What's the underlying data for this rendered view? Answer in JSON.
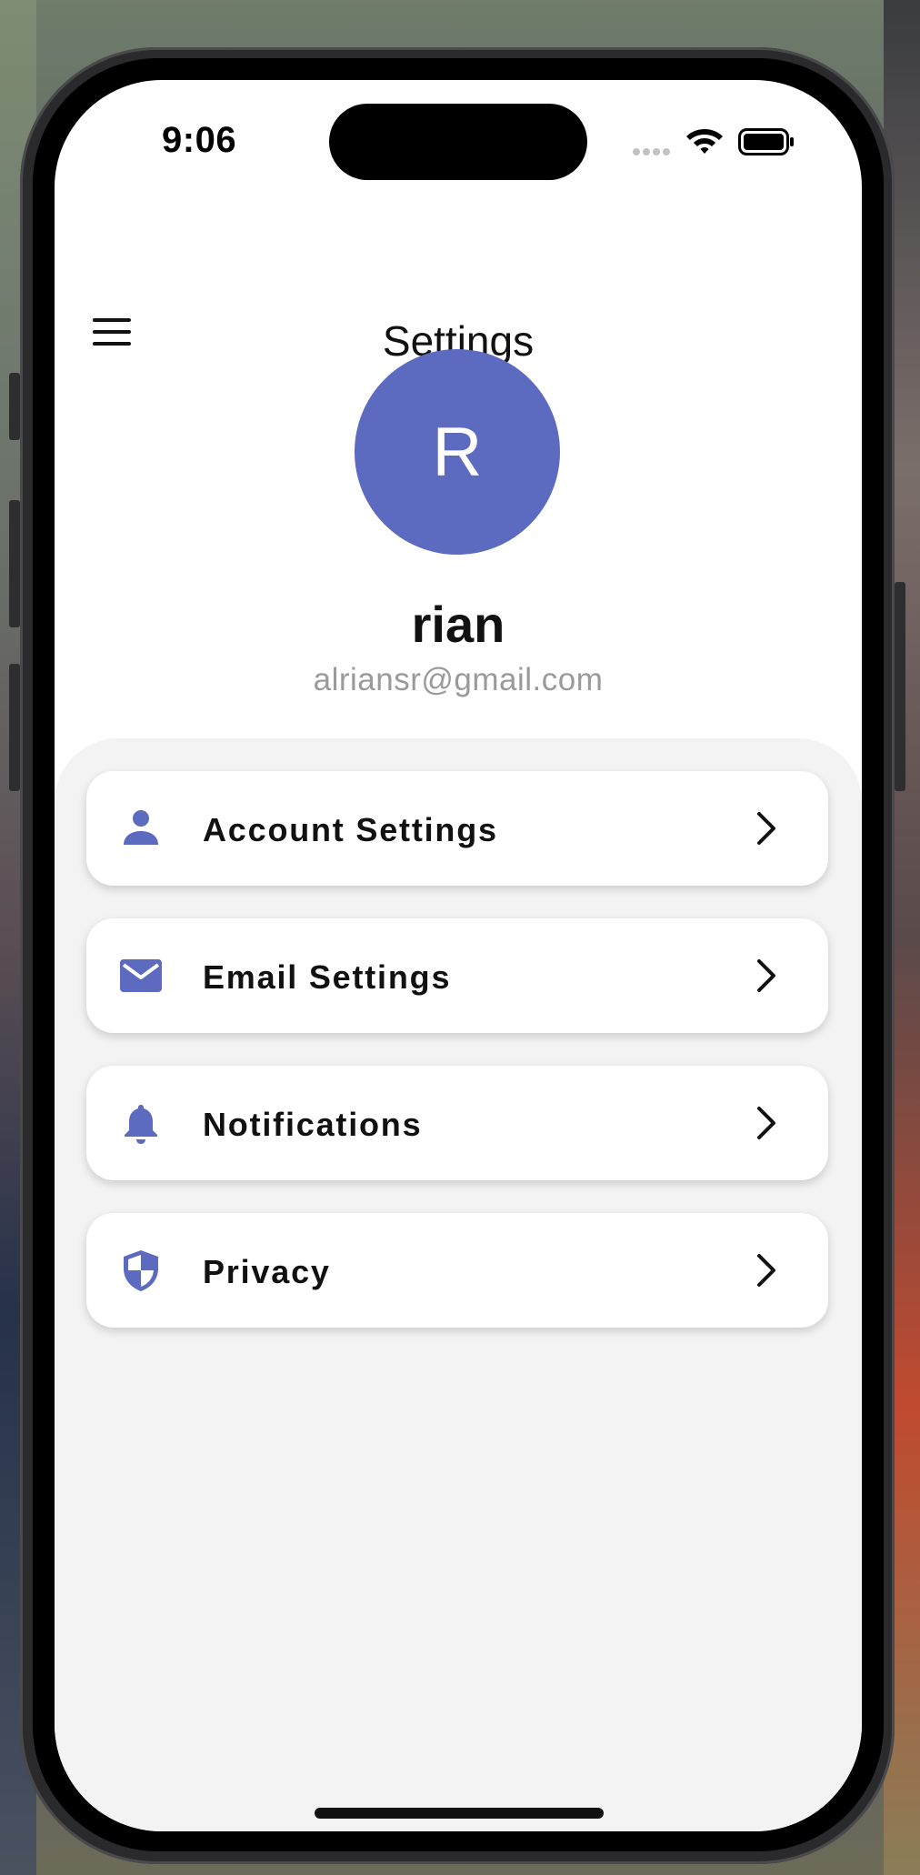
{
  "status_bar": {
    "time": "9:06"
  },
  "header": {
    "title": "Settings"
  },
  "profile": {
    "avatar_initial": "R",
    "name": "rian",
    "email": "alriansr@gmail.com"
  },
  "menu": [
    {
      "label": "Account Settings",
      "icon": "person-icon"
    },
    {
      "label": "Email Settings",
      "icon": "email-icon"
    },
    {
      "label": "Notifications",
      "icon": "bell-icon"
    },
    {
      "label": "Privacy",
      "icon": "shield-icon"
    }
  ],
  "colors": {
    "accent": "#5c6bc0",
    "panel_background": "#f3f3f3",
    "email_gray": "#9a9a9a"
  }
}
